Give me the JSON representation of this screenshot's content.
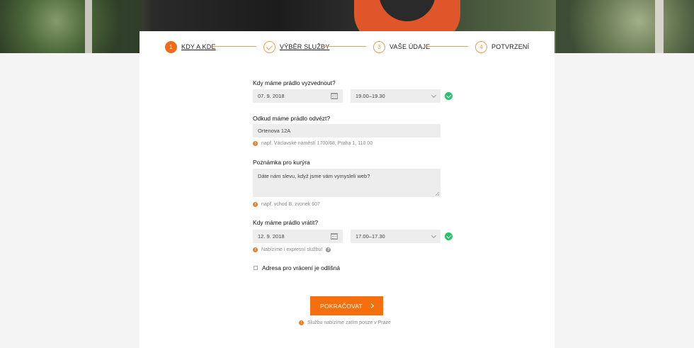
{
  "steps": [
    {
      "number": "1",
      "label": "KDY A KDE"
    },
    {
      "label": "VÝBĚR SLUŽBY"
    },
    {
      "number": "3",
      "label": "VAŠE ÚDAJE"
    },
    {
      "number": "4",
      "label": "POTVRZENÍ"
    }
  ],
  "pickup": {
    "label": "Kdy máme prádlo vyzvednout?",
    "date": "07. 9. 2018",
    "time": "19.00–19.30"
  },
  "address": {
    "label": "Odkud máme prádlo odvézt?",
    "value": "Ortenova 12A",
    "hint": "např. Václavské náměstí 1700/68, Praha 1, 110 00"
  },
  "note": {
    "label": "Poznámka pro kurýra",
    "value": "Dáte nám slevu, když jsme vám vymysleli web?",
    "hint": "např. vchod B, zvonek 607"
  },
  "return": {
    "label": "Kdy máme prádlo vrátit?",
    "date": "12. 9. 2018",
    "time": "17.00–17.30",
    "hint": "Nabízíme i expresní službu!"
  },
  "different_address": {
    "label": "Adresa pro vrácení je odlišná",
    "checked": false
  },
  "continue_button": "POKRAČOVAT",
  "footer_hint": "Službu nabízíme zatím pouze v Praze",
  "colors": {
    "accent": "#f56f0e",
    "success": "#27c26b",
    "field_bg": "#ededed"
  }
}
